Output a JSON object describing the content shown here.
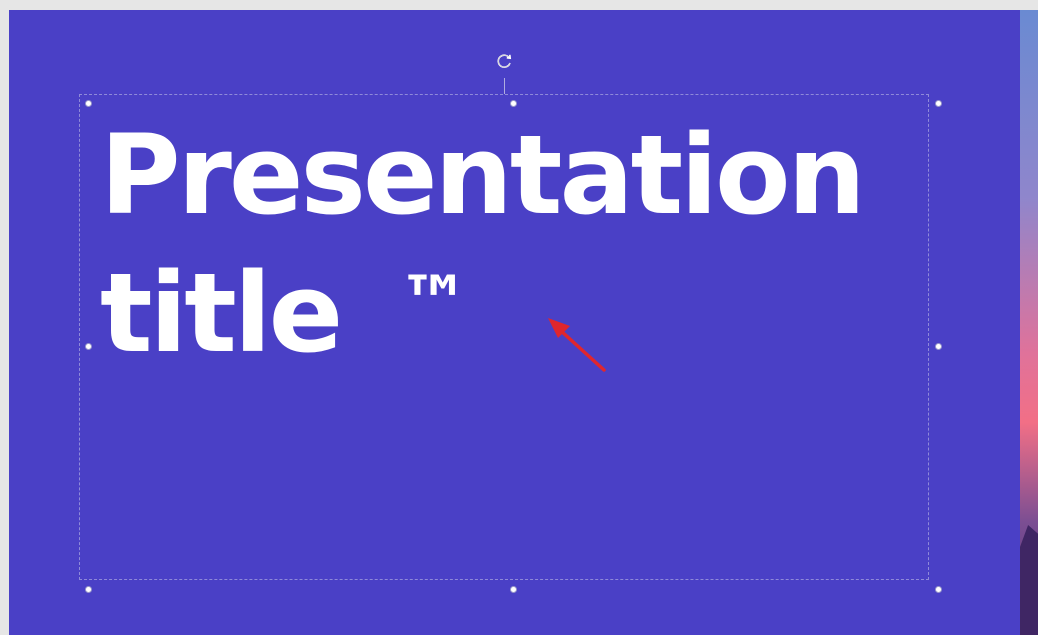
{
  "slide": {
    "title_line_1": "Presentation",
    "title_line_2": "title",
    "trademark_symbol": "™",
    "background_color": "#4a40c6",
    "text_color": "#ffffff"
  },
  "selection": {
    "rotate_icon": "rotate-icon",
    "handles": [
      "top-left",
      "top-center",
      "top-right",
      "middle-left",
      "middle-right",
      "bottom-left",
      "bottom-center",
      "bottom-right"
    ]
  },
  "annotation": {
    "arrow_icon": "arrow-icon",
    "arrow_color": "#e0262e"
  },
  "next_slide_preview": {
    "gradient_colors": [
      "#6a8ad2",
      "#8f86cc",
      "#f26f86",
      "#4a2c72"
    ]
  }
}
